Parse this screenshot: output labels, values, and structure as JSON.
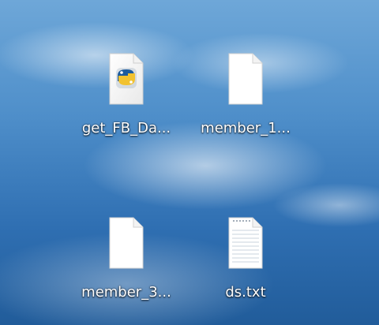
{
  "desktop": {
    "icons": [
      {
        "label": "get_FB_Da...",
        "icon": "python-file-icon"
      },
      {
        "label": "member_1...",
        "icon": "blank-file-icon"
      },
      {
        "label": "member_3...",
        "icon": "blank-file-icon"
      },
      {
        "label": "ds.txt",
        "icon": "text-file-icon"
      }
    ]
  }
}
